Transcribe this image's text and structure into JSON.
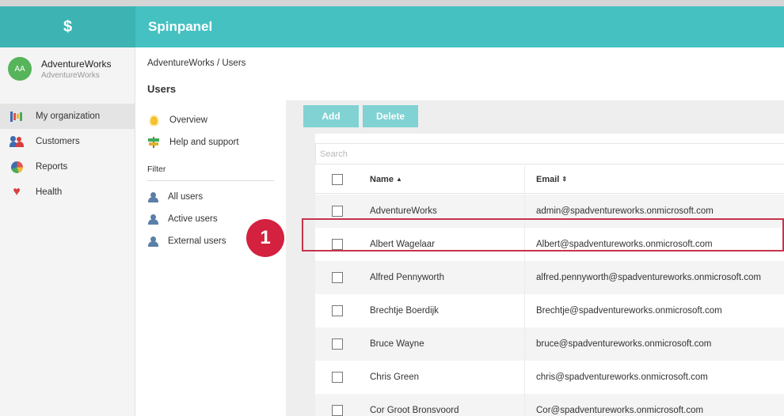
{
  "header": {
    "logo_glyph": "$",
    "app_title": "Spinpanel"
  },
  "org": {
    "avatar_initials": "AA",
    "name": "AdventureWorks",
    "subtitle": "AdventureWorks"
  },
  "nav": {
    "items": [
      {
        "label": "My organization",
        "icon": "org-chart-icon",
        "active": true
      },
      {
        "label": "Customers",
        "icon": "customers-icon",
        "active": false
      },
      {
        "label": "Reports",
        "icon": "pie-chart-icon",
        "active": false
      },
      {
        "label": "Health",
        "icon": "heart-icon",
        "active": false
      }
    ]
  },
  "mid": {
    "breadcrumb": "AdventureWorks / Users",
    "title": "Users",
    "links": [
      {
        "label": "Overview",
        "icon": "lightbulb-icon"
      },
      {
        "label": "Help and support",
        "icon": "signpost-icon"
      }
    ],
    "filter_label": "Filter",
    "filters": [
      {
        "label": "All users",
        "icon": "user-icon"
      },
      {
        "label": "Active users",
        "icon": "user-icon"
      },
      {
        "label": "External users",
        "icon": "user-icon"
      }
    ]
  },
  "callout": {
    "number": "1"
  },
  "toolbar": {
    "add_label": "Add",
    "delete_label": "Delete"
  },
  "search": {
    "placeholder": "Search",
    "value": ""
  },
  "table": {
    "columns": [
      {
        "label": "Name",
        "sort_glyph": "▲"
      },
      {
        "label": "Email",
        "sort_glyph": "⇕"
      }
    ],
    "rows": [
      {
        "name": "AdventureWorks",
        "email": "admin@spadventureworks.onmicrosoft.com"
      },
      {
        "name": "Albert Wagelaar",
        "email": "Albert@spadventureworks.onmicrosoft.com"
      },
      {
        "name": "Alfred Pennyworth",
        "email": "alfred.pennyworth@spadventureworks.onmicrosoft.com"
      },
      {
        "name": "Brechtje Boerdijk",
        "email": "Brechtje@spadventureworks.onmicrosoft.com"
      },
      {
        "name": "Bruce Wayne",
        "email": "bruce@spadventureworks.onmicrosoft.com"
      },
      {
        "name": "Chris Green",
        "email": "chris@spadventureworks.onmicrosoft.com"
      },
      {
        "name": "Cor Groot Bronsvoord",
        "email": "Cor@spadventureworks.onmicrosoft.com"
      }
    ]
  },
  "colors": {
    "brand": "#45c1c2",
    "brand_dark": "#3eb3b4",
    "button": "#80d2d3",
    "callout": "#d3213f",
    "highlight": "#c7344d"
  }
}
